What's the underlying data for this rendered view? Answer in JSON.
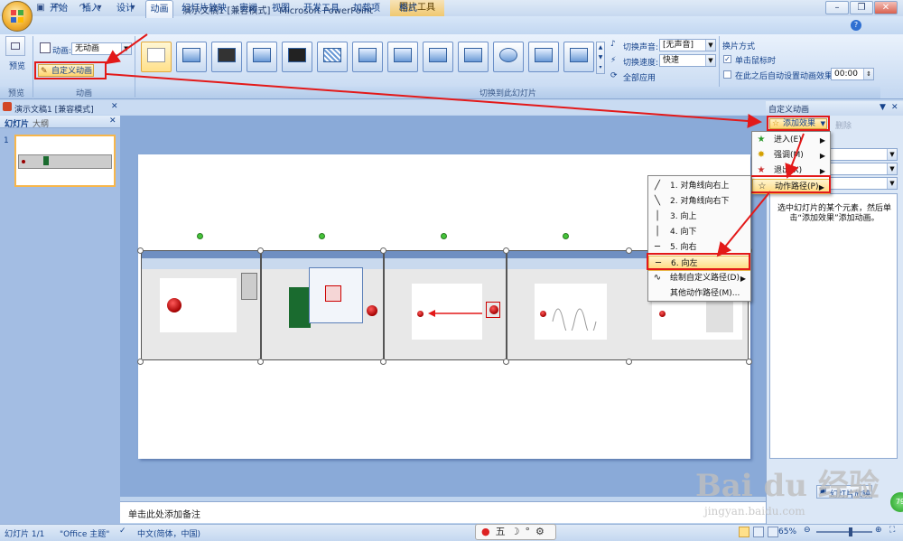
{
  "window": {
    "title": "演示文稿1 [兼容模式] - Microsoft PowerPoint",
    "context_tab": "图片工具"
  },
  "colors": {
    "accent": "#15428b",
    "highlight": "#ffd97a",
    "annotation_red": "#e31919"
  },
  "tabs": [
    "开始",
    "插入",
    "设计",
    "动画",
    "幻灯片放映",
    "审阅",
    "视图",
    "开发工具",
    "加载项",
    "格式"
  ],
  "active_tab": "动画",
  "ribbon": {
    "preview_label": "预览",
    "preview_group": "预览",
    "animation_label": "动画:",
    "animation_value": "无动画",
    "custom_animation": "自定义动画",
    "animation_group": "动画",
    "transition_group": "切换到此幻灯片",
    "sound_label": "切换声音:",
    "sound_value": "[无声音]",
    "speed_label": "切换速度:",
    "speed_value": "快速",
    "apply_all": "全部应用",
    "advance_title": "换片方式",
    "on_click": "单击鼠标时",
    "after_time": "在此之后自动设置动画效果:",
    "after_value": "00:00"
  },
  "doc_tab": "演示文稿1 [兼容模式]",
  "left_pane": {
    "tab_slides": "幻灯片",
    "tab_outline": "大纲",
    "slide_number": "1"
  },
  "right_pane": {
    "title": "自定义动画",
    "add_effect": "添加效果",
    "remove": "删除",
    "hint": "选中幻灯片的某个元素，然后单击“添加效果”添加动画。",
    "play": "幻灯片放映"
  },
  "effect_menu": [
    {
      "label": "进入(E)",
      "icon": "enter-star-icon"
    },
    {
      "label": "强调(M)",
      "icon": "emphasis-star-icon"
    },
    {
      "label": "退出(X)",
      "icon": "exit-star-icon"
    },
    {
      "label": "动作路径(P)",
      "icon": "path-star-icon",
      "highlight": true
    }
  ],
  "path_menu": [
    {
      "label": "1. 对角线向右上",
      "glyph": "╱"
    },
    {
      "label": "2. 对角线向右下",
      "glyph": "╲"
    },
    {
      "label": "3. 向上",
      "glyph": "│"
    },
    {
      "label": "4. 向下",
      "glyph": "│"
    },
    {
      "label": "5. 向右",
      "glyph": "─"
    },
    {
      "label": "6. 向左",
      "glyph": "─",
      "highlight": true
    },
    {
      "label": "绘制自定义路径(D)",
      "glyph": "∿",
      "submenu": true
    },
    {
      "label": "其他动作路径(M)...",
      "glyph": ""
    }
  ],
  "notes_placeholder": "单击此处添加备注",
  "status": {
    "slide": "幻灯片 1/1",
    "theme": "\"Office 主题\"",
    "language": "中文(简体，中国)",
    "zoom": "65%"
  },
  "watermark": {
    "brand": "Bai du 经验",
    "url": "jingyan.baidu.com"
  }
}
